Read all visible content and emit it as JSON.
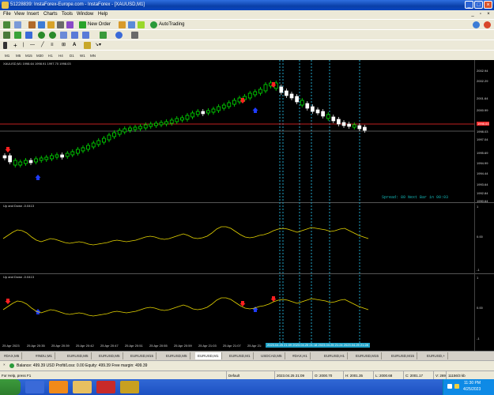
{
  "window": {
    "title": "51228839: InstaForex-Europe.com - InstaForex - [XAUUSD,M1]"
  },
  "menu": [
    "File",
    "View",
    "Insert",
    "Charts",
    "Tools",
    "Window",
    "Help"
  ],
  "toolbar": {
    "new_order": "New Order",
    "autotrading": "AutoTrading"
  },
  "timeframes": [
    "M1",
    "M5",
    "M15",
    "M30",
    "H1",
    "H4",
    "D1",
    "W1",
    "MN"
  ],
  "chart": {
    "symbol_header": "XAUUSD,M1  1998.64 1998.91 1997.70 1998.03",
    "price_labels": [
      "2002.94",
      "2002.29",
      "2001.64",
      "2000.99",
      "2000.24",
      "1998.03",
      "1997.04",
      "1995.69",
      "1994.99",
      "1994.44",
      "1993.64",
      "1992.84",
      "1990.64"
    ],
    "bid_marker": "1998.03",
    "spread_text": "Spread: 80  Next Bar in 00:03",
    "indicator1": {
      "title": "Up and Down -0.0413",
      "top": "1",
      "mid": "0.00",
      "bottom": "-1"
    },
    "indicator2": {
      "title": "Up and Down -0.0413",
      "top": "1",
      "mid": "0.00",
      "bottom": "-1"
    },
    "time_labels": [
      "25 Apr 2023",
      "25 Apr 20:35",
      "25 Apr 20:39",
      "25 Apr 20:42",
      "25 Apr 20:47",
      "25 Apr 20:51",
      "25 Apr 20:55",
      "25 Apr 20:59",
      "25 Apr 21:03",
      "25 Apr 21:07",
      "25 Apr 21:"
    ],
    "time_highlight": "2023.04.25 21:09   2023.04.25 21:18   2023.04.25 21:24   2023.04.25 21:28"
  },
  "tabs": [
    "#DAX,M5",
    "#INDU,M1",
    "EURUSD,M5",
    "EURUSD,M5",
    "EURUSD,M15",
    "EURUSD,M5",
    "EURUSD,M1",
    "EURUSD,M1",
    "USDCAD,M5",
    "#DAX,H1",
    "EURUSD,H1",
    "EURUSD,M15",
    "EURUSD,M15",
    "EURUSD,+"
  ],
  "balance": {
    "text": "Balance: 499.39 USD  Profit/Loss: 0.00  Equity: 499.39  Free margin: 499.39"
  },
  "status": {
    "help": "For Help, press F1",
    "profile": "Default",
    "datetime": "2023.04.25 21:09",
    "open": "O: 2000.70",
    "high": "H: 2001.35",
    "low": "L: 2000.68",
    "close": "C: 2001.17",
    "volume": "V: 269",
    "traffic": "11156/3 kb"
  },
  "clock": {
    "time": "11:30 PM",
    "date": "4/25/2023"
  },
  "colors": {
    "bull": "#00ff00",
    "bear": "#ffffff",
    "indicator": "#e5d400",
    "bid_line": "#ff2a2a",
    "cursor": "#1fa3c8",
    "arrow_up": "#1f3cff",
    "arrow_down": "#ff2020"
  }
}
